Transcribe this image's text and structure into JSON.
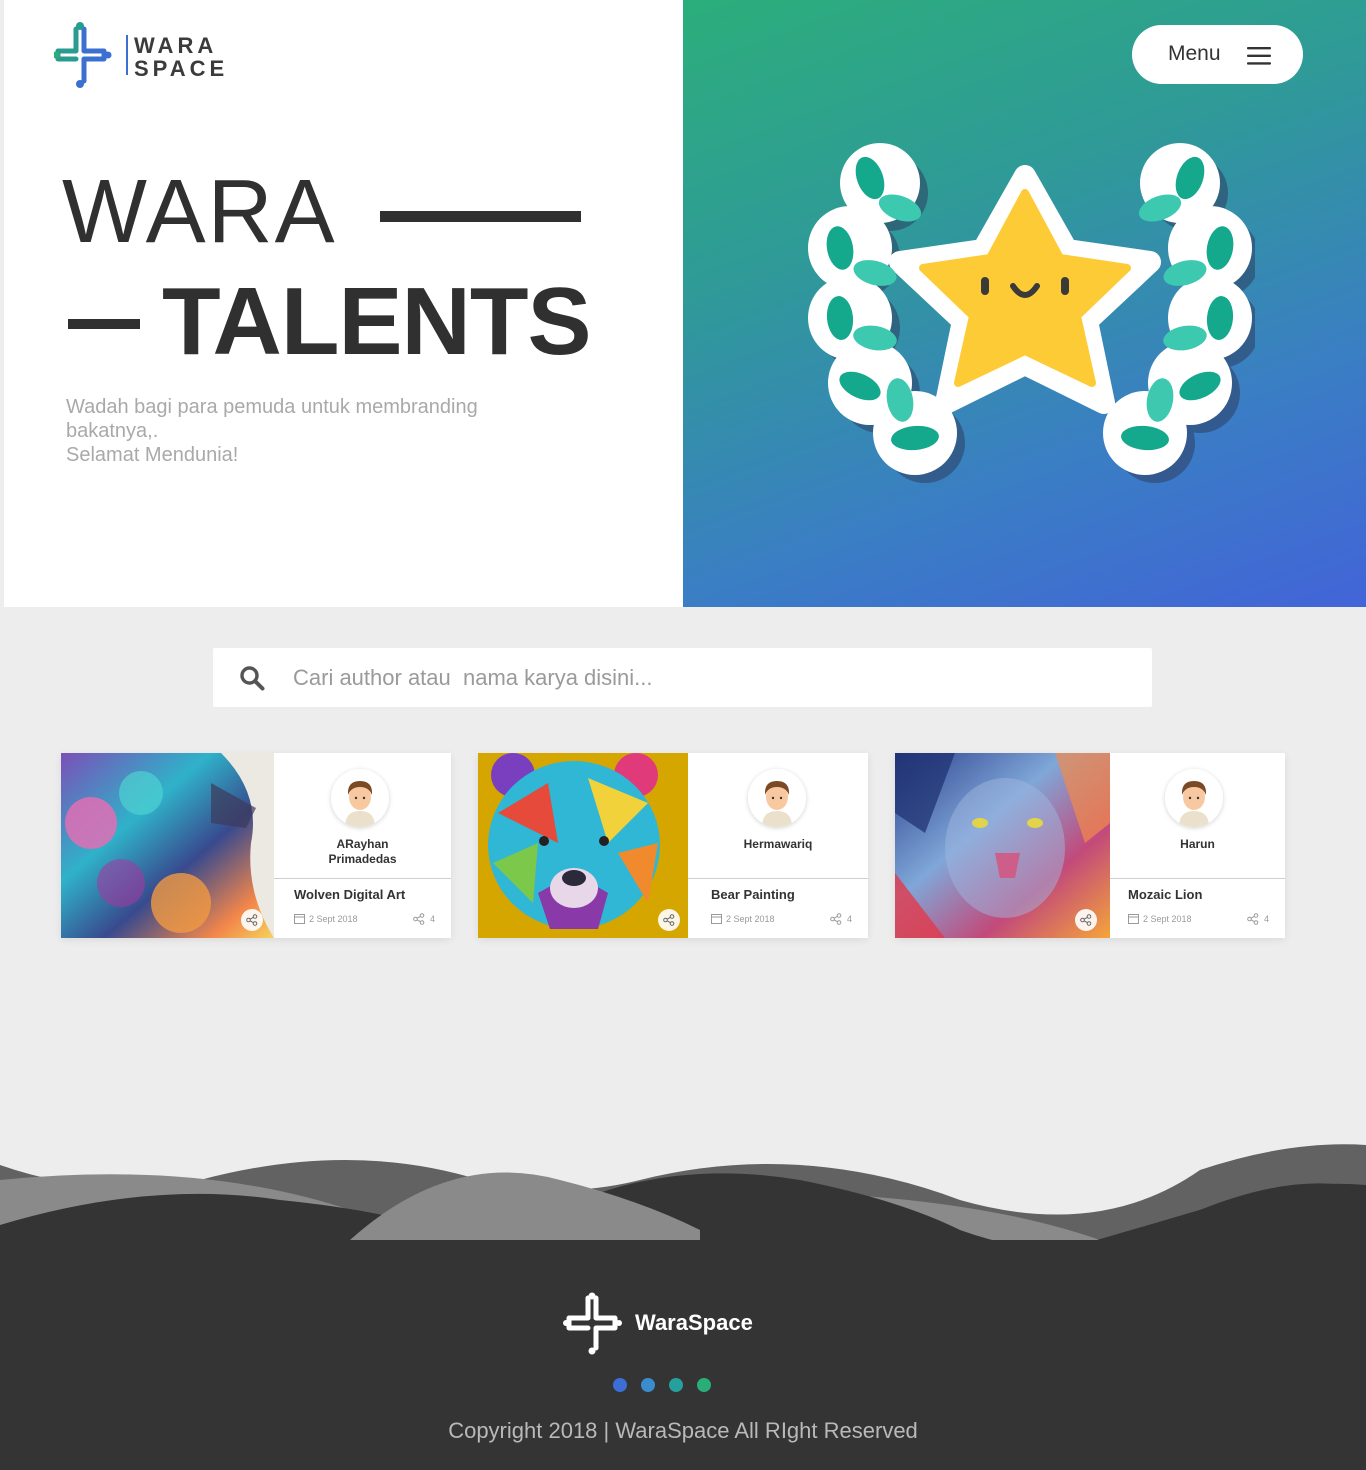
{
  "brand": {
    "logo_line1": "WARA",
    "logo_line2": "SPACE",
    "footer_name": "WaraSpace"
  },
  "header": {
    "menu_label": "Menu"
  },
  "hero": {
    "title_line1": "WARA",
    "title_line2": "TALENTS",
    "description_line1": "Wadah bagi para pemuda untuk membranding",
    "description_line2": "bakatnya,.",
    "description_line3": "Selamat Mendunia!"
  },
  "search": {
    "placeholder": "Cari author atau  nama karya disini..."
  },
  "cards": [
    {
      "author": "ARayhan Primadedas",
      "title": "Wolven Digital Art",
      "date": "2 Sept 2018",
      "shares": "4"
    },
    {
      "author": "Hermawariq",
      "title": "Bear Painting",
      "date": "2 Sept 2018",
      "shares": "4"
    },
    {
      "author": "Harun",
      "title": "Mozaic Lion",
      "date": "2 Sept 2018",
      "shares": "4"
    }
  ],
  "footer": {
    "dot_colors": [
      "#3c6fd6",
      "#3a8ccd",
      "#26a09c",
      "#2aae77"
    ],
    "copyright": "Copyright 2018 | WaraSpace All RIght Reserved"
  },
  "colors": {
    "hero_gradient_start": "#2cae7b",
    "hero_gradient_end": "#4264d8",
    "text_dark": "#303030",
    "footer_bg": "#343434"
  }
}
